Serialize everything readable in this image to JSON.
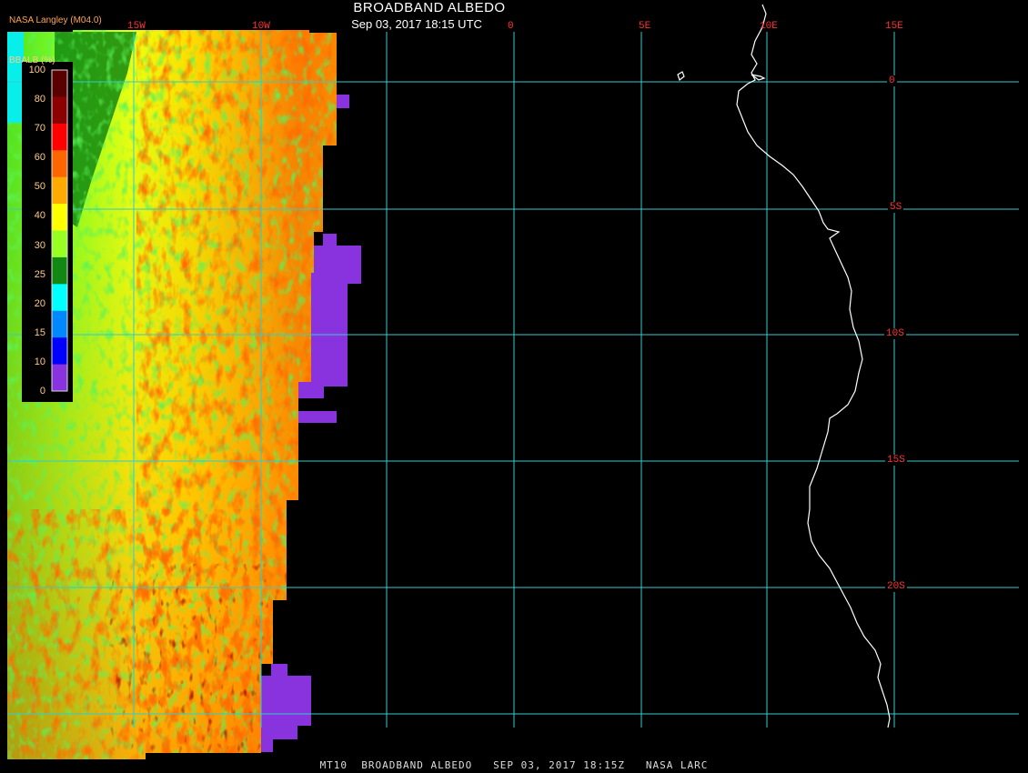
{
  "title": "BROADBAND ALBEDO",
  "subtitle": "Sep 03, 2017 18:15 UTC",
  "source": "NASA Langley (M04.0)",
  "footer": "MT10  BROADBAND ALBEDO   SEP 03, 2017 18:15Z   NASA LARC",
  "legend": {
    "title": "BBALB (%)",
    "labels": [
      "100",
      "80",
      "70",
      "60",
      "50",
      "40",
      "30",
      "25",
      "20",
      "15",
      "10",
      "0"
    ],
    "colors": [
      "#5a0000",
      "#8b0000",
      "#ff0000",
      "#ff6600",
      "#ffaa00",
      "#ffff00",
      "#99ff22",
      "#118811",
      "#00ffff",
      "#0088ff",
      "#0000ff",
      "#8833dd"
    ]
  },
  "grid": {
    "line_color": "#33cccc",
    "label_color": "#ff3333",
    "lon_labels": [
      "15W",
      "10W",
      "0",
      "5E",
      "10E",
      "15E"
    ],
    "lat_labels": [
      "0",
      "5S",
      "10S",
      "15S",
      "20S"
    ]
  }
}
